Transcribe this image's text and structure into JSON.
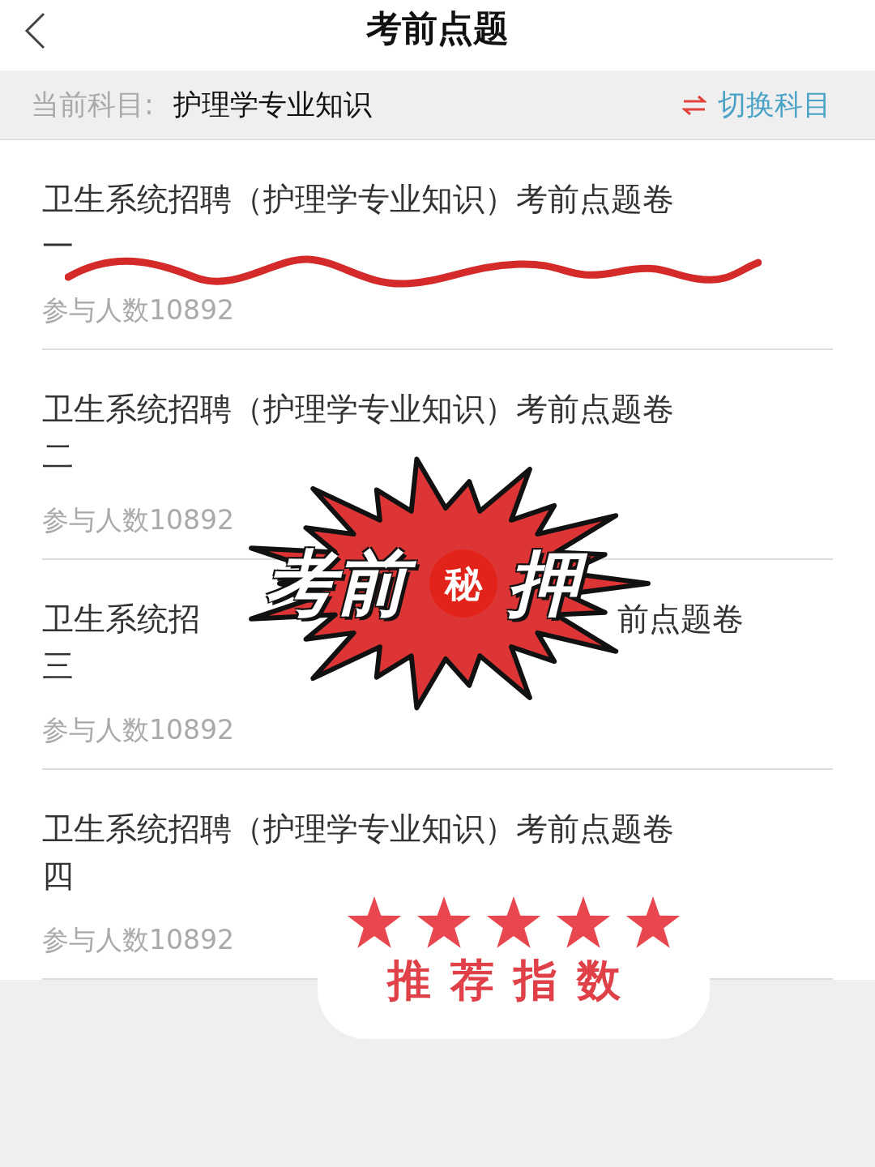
{
  "header": {
    "title": "考前点题"
  },
  "subject_bar": {
    "label": "当前科目:",
    "value": "护理学专业知识",
    "switch_label": "切换科目"
  },
  "papers": [
    {
      "lines": [
        [
          "卫生系统招聘（护理学专业知识）考前点题卷"
        ],
        [
          "一"
        ]
      ],
      "participants": "参与人数10892"
    },
    {
      "lines": [
        [
          "卫生系统招聘（护理学专业知识）考前点题卷"
        ],
        [
          "二"
        ]
      ],
      "participants": "参与人数10892"
    },
    {
      "lines": [
        [
          "卫生系统招",
          "前点题卷"
        ],
        [
          "三"
        ]
      ],
      "participants": "参与人数10892"
    },
    {
      "lines": [
        [
          "卫生系统招聘（护理学专业知识）考前点题卷"
        ],
        [
          "四"
        ]
      ],
      "participants": "参与人数10892"
    }
  ],
  "burst_sticker": {
    "parts": [
      "考前",
      "秘",
      "押"
    ]
  },
  "rating_sticker": {
    "stars": 5,
    "label": "推荐指数"
  }
}
